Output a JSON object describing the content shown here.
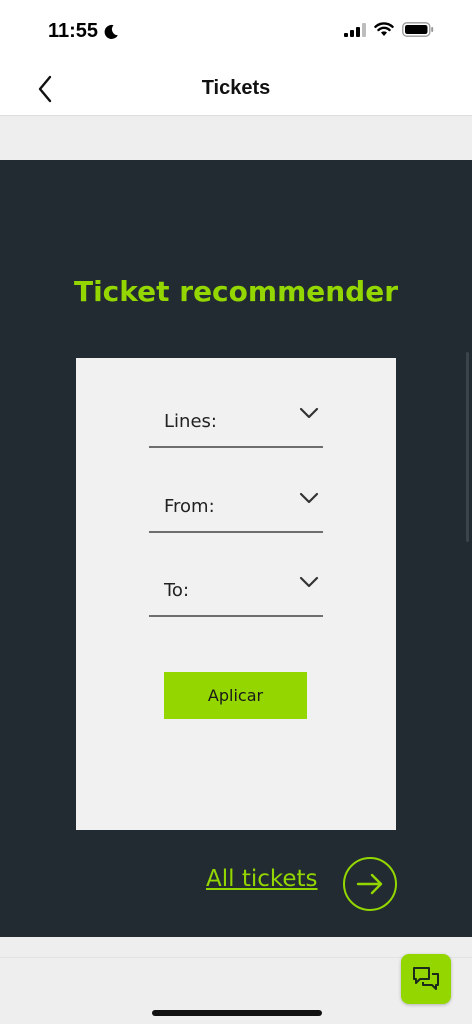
{
  "status_bar": {
    "time": "11:55",
    "icons": [
      "moon-icon",
      "cellular-signal-icon",
      "wifi-icon",
      "battery-icon"
    ]
  },
  "nav": {
    "title": "Tickets",
    "back_icon": "chevron-left-icon"
  },
  "recommender": {
    "title": "Ticket recommender",
    "fields": [
      {
        "label": "Lines:",
        "icon": "chevron-down-icon"
      },
      {
        "label": "From:",
        "icon": "chevron-down-icon"
      },
      {
        "label": "To:",
        "icon": "chevron-down-icon"
      }
    ],
    "apply_label": "Aplicar"
  },
  "all_tickets": {
    "label": "All tickets",
    "icon": "arrow-right-circle-icon"
  },
  "chat": {
    "icon": "chat-bubbles-icon"
  },
  "colors": {
    "accent": "#94d600",
    "dark_bg": "#212b31",
    "card_bg": "#f1f1f1",
    "page_bg": "#eeeeee"
  }
}
